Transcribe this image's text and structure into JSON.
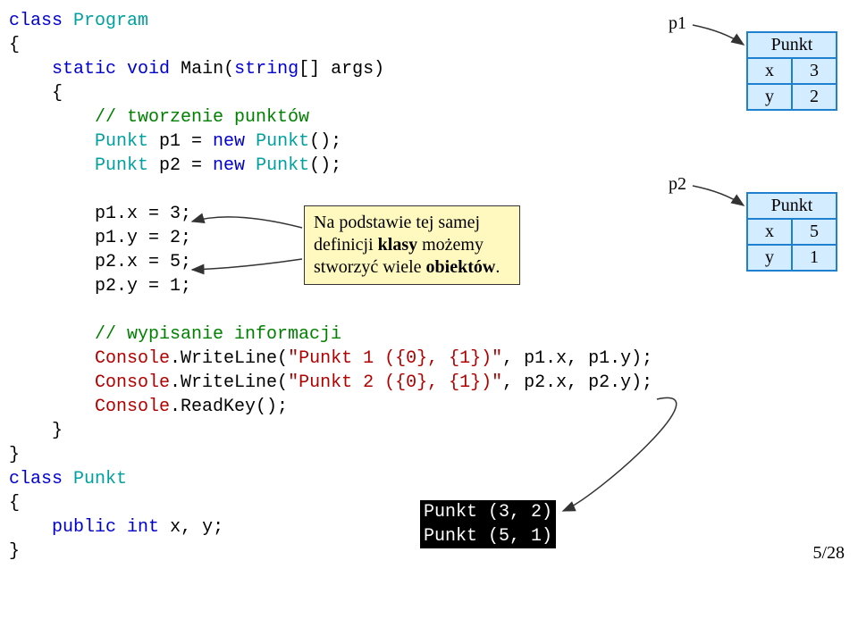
{
  "code": {
    "kw_class": "class",
    "cls_program": "Program",
    "kw_static": "static",
    "kw_void": "void",
    "method_main": "Main",
    "kw_string": "string",
    "param_args": "[] args)",
    "cm_tworzenie": "// tworzenie punktów",
    "cls_punkt": "Punkt",
    "var_p1": " p1 = ",
    "kw_new1": "new",
    "ctor1": "();",
    "var_p2": " p2 = ",
    "kw_new2": "new",
    "ctor2": "();",
    "assign_p1x": "p1.x = 3;",
    "assign_p1y": "p1.y = 2;",
    "assign_p2x": "p2.x = 5;",
    "assign_p2y": "p2.y = 1;",
    "cm_wypisanie": "// wypisanie informacji",
    "stm_console": "Console",
    "write1a": ".WriteLine(",
    "str1": "\"Punkt 1 ({0}, {1})\"",
    "write1b": ", p1.x, p1.y);",
    "write2a": ".WriteLine(",
    "str2": "\"Punkt 2 ({0}, {1})\"",
    "write2b": ", p2.x, p2.y);",
    "readkey": ".ReadKey();",
    "kw_class2": "class",
    "kw_public": "public",
    "kw_int": "int",
    "fields": " x, y;"
  },
  "callout": {
    "line1": "Na podstawie tej samej",
    "line2_a": "definicji ",
    "line2_b": "klasy",
    "line2_c": " możemy",
    "line3_a": "stworzyć wiele ",
    "line3_b": "obiektów",
    "line3_c": "."
  },
  "objects": {
    "p1_label": "p1",
    "p2_label": "p2",
    "punkt_label": "Punkt",
    "x_label": "x",
    "y_label": "y",
    "p1_x": "3",
    "p1_y": "2",
    "p2_x": "5",
    "p2_y": "1"
  },
  "console_output": {
    "line1": "Punkt (3, 2)",
    "line2": "Punkt (5, 1)"
  },
  "page_number": "5/28"
}
